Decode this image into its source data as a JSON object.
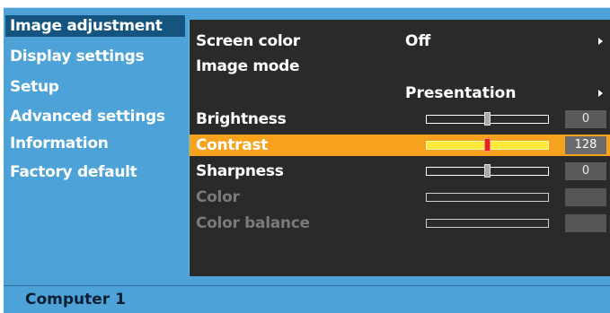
{
  "left_menu": [
    {
      "label": "Image adjustment",
      "active": true
    },
    {
      "label": "Display settings",
      "active": false
    },
    {
      "label": "Setup",
      "active": false
    },
    {
      "label": "Advanced settings",
      "active": false
    },
    {
      "label": "Information",
      "active": false
    },
    {
      "label": "Factory default",
      "active": false
    }
  ],
  "settings": {
    "screen_color": {
      "label": "Screen color",
      "value": "Off"
    },
    "image_mode": {
      "label": "Image mode",
      "value": "Presentation"
    },
    "brightness": {
      "label": "Brightness",
      "value": "0",
      "level": 0.5
    },
    "contrast": {
      "label": "Contrast",
      "value": "128",
      "level": 0.5
    },
    "sharpness": {
      "label": "Sharpness",
      "value": "0",
      "level": 0.5
    },
    "color": {
      "label": "Color",
      "value": ""
    },
    "color_balance": {
      "label": "Color balance",
      "value": ""
    }
  },
  "status": {
    "source": "Computer 1"
  },
  "colors": {
    "menu_bg": "#4da3d8",
    "active_bg": "#14547f",
    "highlight": "#f7a21d",
    "panel_bg": "#2a2a2a"
  },
  "icons": [
    "right-arrow-icon"
  ]
}
